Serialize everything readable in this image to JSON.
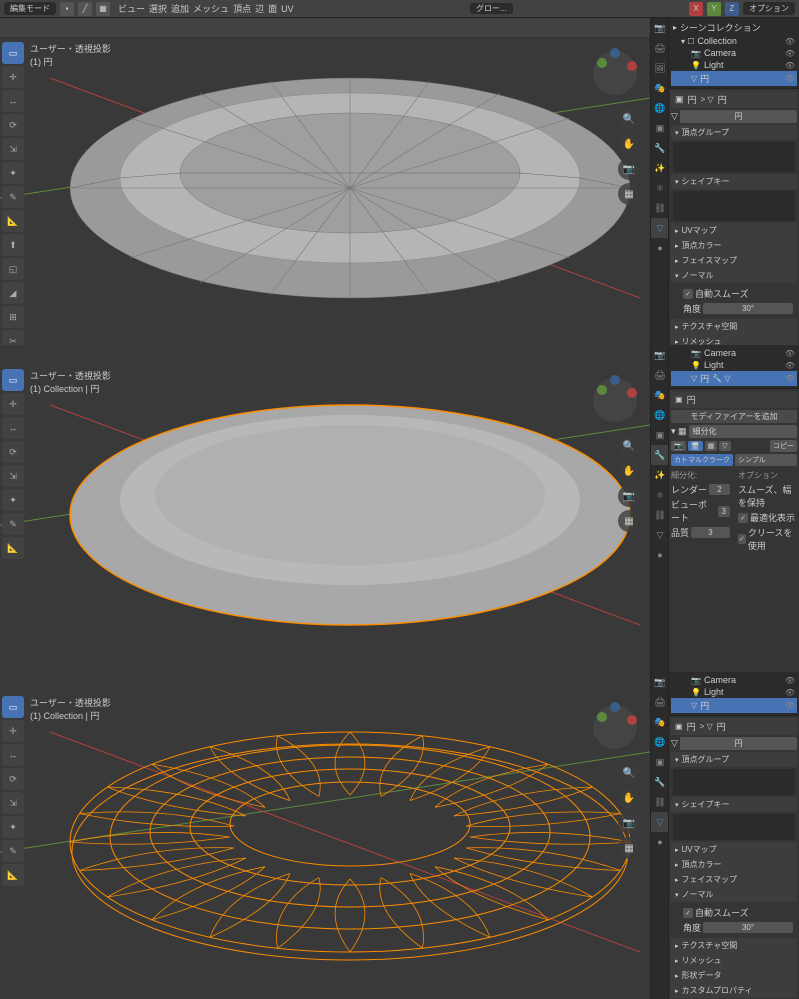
{
  "header": {
    "mode": "編集モード",
    "menus": [
      "ビュー",
      "選択",
      "追加",
      "メッシュ",
      "頂点",
      "辺",
      "面",
      "UV"
    ],
    "center": "グロー...",
    "right": [
      "オプション"
    ],
    "xyz": [
      "X",
      "Y",
      "Z"
    ]
  },
  "viewports": [
    {
      "title": "ユーザー・透視投影",
      "sub": "(1) 円"
    },
    {
      "title": "ユーザー・透視投影",
      "sub": "(1) Collection | 円"
    },
    {
      "title": "ユーザー・透視投影",
      "sub": "(1) Collection | 円"
    }
  ],
  "outliner": {
    "scene": "シーンコレクション",
    "collection": "Collection",
    "items": [
      "Camera",
      "Light",
      "円"
    ]
  },
  "props": {
    "name": "円",
    "panels": [
      "頂点グループ",
      "シェイプキー",
      "UVマップ",
      "頂点カラー",
      "フェイスマップ",
      "ノーマル",
      "テクスチャ空間",
      "リメッシュ",
      "形状データ",
      "カスタムプロパティ"
    ],
    "normal_sub": "自動スムーズ",
    "angle_label": "角度",
    "angle_val": "30°"
  },
  "modifier": {
    "add": "モディファイアーを追加",
    "name": "細分化",
    "type": "カトマルクラーク",
    "simple": "シンプル",
    "copy": "コピー",
    "section": "細分化:",
    "options": "オプション",
    "render": "レンダー",
    "render_v": "2",
    "viewport": "ビューポート",
    "viewport_v": "3",
    "quality": "品質",
    "quality_v": "3",
    "opt1": "スムーズ、幅を保持",
    "opt2": "最適化表示",
    "opt3": "クリースを使用"
  }
}
